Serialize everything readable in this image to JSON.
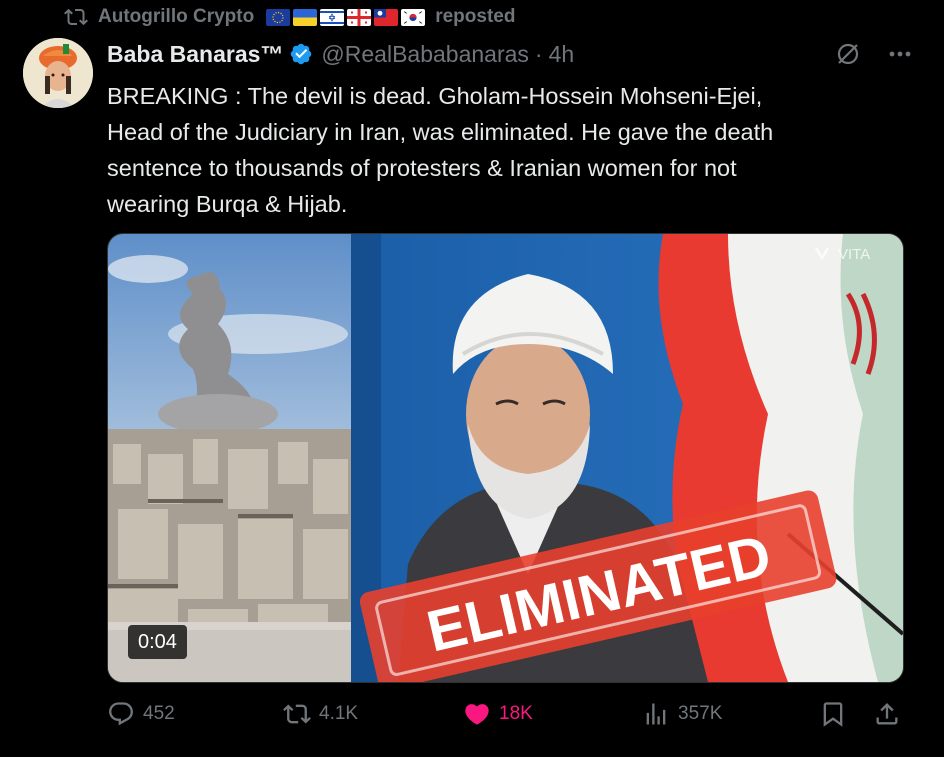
{
  "repost": {
    "author": "Autogrillo Crypto",
    "label": "reposted",
    "flags": [
      "eu-flag",
      "ukraine-flag",
      "israel-flag",
      "georgia-flag",
      "taiwan-flag",
      "south-korea-flag"
    ]
  },
  "author": {
    "name": "Baba Banaras™",
    "handle": "@RealBababanaras",
    "separator": "·",
    "time": "4h",
    "verified": true
  },
  "tweet_text": "BREAKING : The devil is dead. Gholam-Hossein Mohseni-Ejei,\nHead of the Judiciary in Iran, was eliminated. He gave the death\nsentence to thousands of protesters & Iranian women for not\nwearing Burqa & Hijab.",
  "media": {
    "duration": "0:04",
    "overlay_text": "ELIMINATED",
    "watermark": "VITA"
  },
  "actions": {
    "replies": "452",
    "reposts": "4.1K",
    "likes": "18K",
    "views": "357K"
  },
  "colors": {
    "background": "#000000",
    "primary_text": "#e7e9ea",
    "secondary_text": "#71767b",
    "like": "#f91880",
    "verified": "#1d9bf0"
  }
}
